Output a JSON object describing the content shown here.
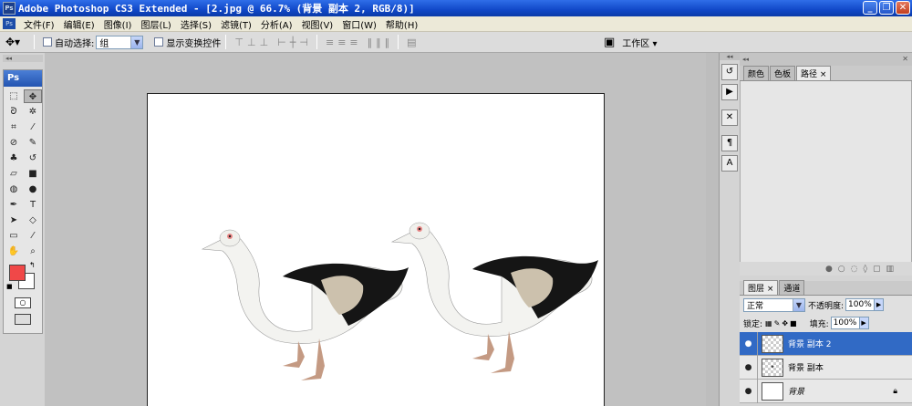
{
  "window": {
    "title": "Adobe Photoshop CS3 Extended - [2.jpg @ 66.7% (背景 副本 2, RGB/8)]",
    "app_icon": "Ps",
    "buttons": [
      "minimize-icon",
      "restore-icon",
      "close-icon"
    ]
  },
  "menu": [
    "文件(F)",
    "编辑(E)",
    "图像(I)",
    "图层(L)",
    "选择(S)",
    "滤镜(T)",
    "分析(A)",
    "视图(V)",
    "窗口(W)",
    "帮助(H)"
  ],
  "options": {
    "auto_select_label": "自动选择:",
    "auto_select_value": "组",
    "show_transform_label": "显示变换控件",
    "workspace_label": "工作区 ▾"
  },
  "toolbox": {
    "header": "Ps"
  },
  "top_panel": {
    "tabs": [
      "颜色",
      "色板",
      "路径 ×"
    ],
    "active_tab": "路径"
  },
  "layers_panel": {
    "tabs": [
      "图层 ×",
      "通道"
    ],
    "blend_mode": "正常",
    "opacity_label": "不透明度:",
    "opacity_value": "100%",
    "lock_label": "锁定:",
    "fill_label": "填充:",
    "fill_value": "100%",
    "layers": [
      {
        "name": "背景 副本 2",
        "selected": true
      },
      {
        "name": "背景 副本",
        "selected": false
      },
      {
        "name": "背景",
        "selected": false
      }
    ]
  },
  "colors": {
    "foreground": "#f04848",
    "background": "#ffffff",
    "accent": "#316ac5"
  }
}
